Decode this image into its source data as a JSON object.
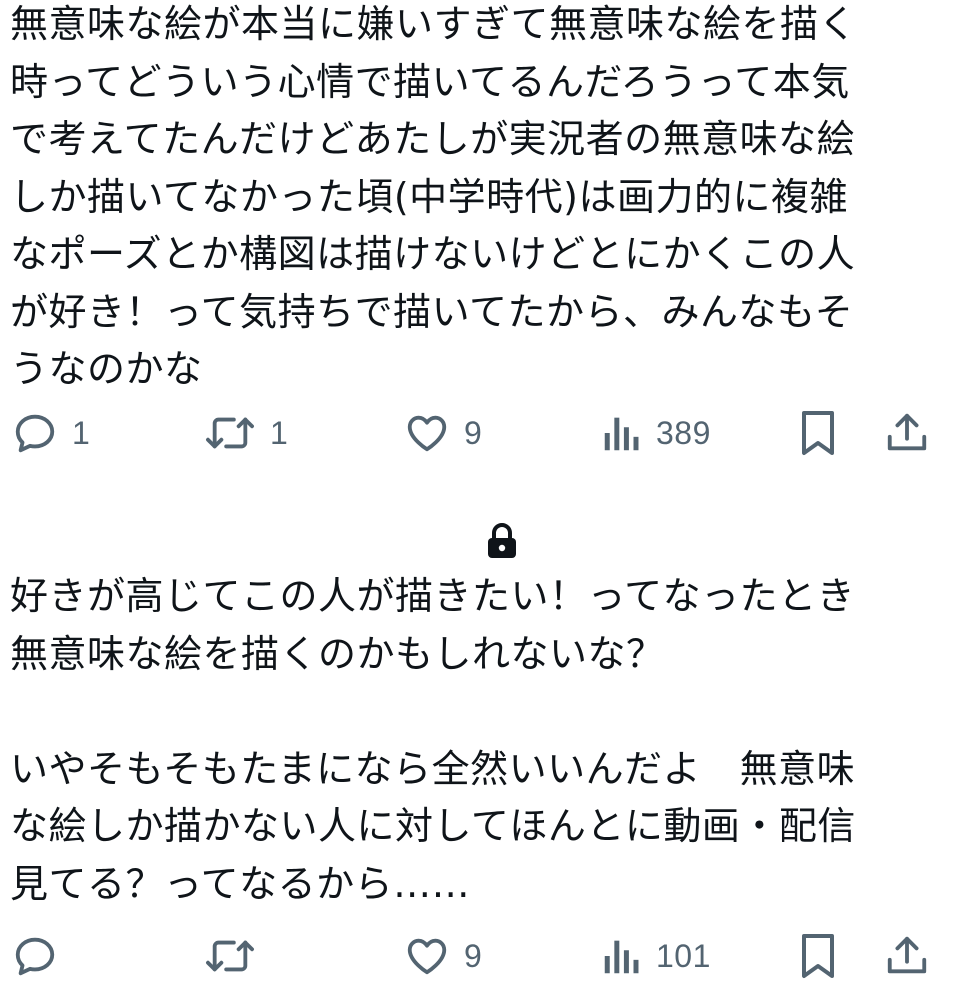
{
  "tweets": [
    {
      "text_lines": [
        "無意味な絵が本当に嫌いすぎて無意味な絵を描く",
        "時ってどういう心情で描いてるんだろうって本気",
        "で考えてたんだけどあたしが実況者の無意味な絵",
        "しか描いてなかった頃(中学時代)は画力的に複雑",
        "なポーズとか構図は描けないけどとにかくこの人",
        "が好き！って気持ちで描いてたから、みんなもそ",
        "うなのかな"
      ],
      "actions": {
        "reply_count": "1",
        "retweet_count": "1",
        "like_count": "9",
        "view_count": "389"
      }
    },
    {
      "text_lines": [
        "好きが高じてこの人が描きたい！ってなったとき",
        "無意味な絵を描くのかもしれないな？",
        "",
        "いやそもそもたまになら全然いいんだよ　無意味",
        "な絵しか描かない人に対してほんとに動画・配信",
        "見てる？ってなるから……"
      ],
      "actions": {
        "reply_count": "",
        "retweet_count": "",
        "like_count": "9",
        "view_count": "101"
      }
    }
  ],
  "icons": {
    "reply": "reply-icon",
    "retweet": "retweet-icon",
    "like": "heart-icon",
    "views": "views-icon",
    "bookmark": "bookmark-icon",
    "share": "share-icon",
    "lock": "lock-icon"
  },
  "colors": {
    "text": "#0f1419",
    "icon": "#536471"
  }
}
